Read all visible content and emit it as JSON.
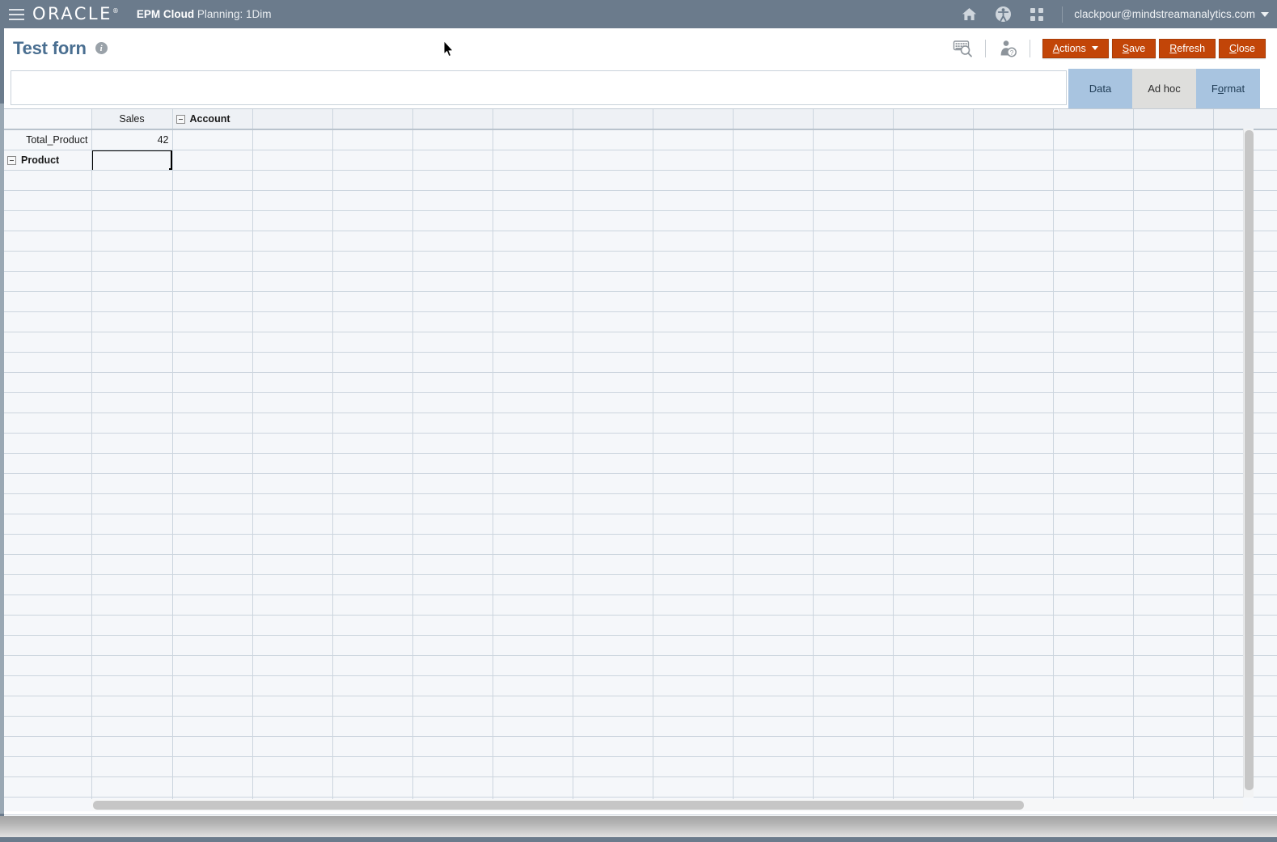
{
  "global_header": {
    "menu_icon": "hamburger-menu-icon",
    "brand": "ORACLE",
    "brand_mark": "®",
    "app_name_bold": "EPM Cloud",
    "app_name_rest": " Planning: 1Dim",
    "icons": [
      {
        "name": "home-icon",
        "glyph": "⌂"
      },
      {
        "name": "accessibility-icon",
        "glyph": "Ⓙ"
      },
      {
        "name": "app-switcher-icon",
        "glyph": "∷"
      }
    ],
    "user": "clackpour@mindstreamanalytics.com"
  },
  "title_bar": {
    "title": "Test forn",
    "info_glyph": "i",
    "tool_icons": [
      {
        "name": "keyboard-search-icon"
      },
      {
        "name": "user-help-icon"
      }
    ],
    "buttons": [
      {
        "name": "actions-button",
        "label": "Actions",
        "accel": "A",
        "caret": true
      },
      {
        "name": "save-button",
        "label": "Save",
        "accel": "S",
        "caret": false
      },
      {
        "name": "refresh-button",
        "label": "Refresh",
        "accel": "R",
        "caret": false
      },
      {
        "name": "close-button",
        "label": "Close",
        "accel": "C",
        "caret": false
      }
    ]
  },
  "pov": {
    "value": "",
    "placeholder": ""
  },
  "side_tabs": [
    {
      "name": "tab-data",
      "label": "Data",
      "accel": "",
      "active": true
    },
    {
      "name": "tab-adhoc",
      "label": "Ad hoc",
      "accel": "",
      "active": false
    },
    {
      "name": "tab-format",
      "label": "Format",
      "accel": "o",
      "active": true
    }
  ],
  "grid": {
    "column_headers": [
      "",
      "Sales",
      "Account"
    ],
    "account_header_collapsible": true,
    "blank_column_count": 13,
    "rows": [
      {
        "header": "Total_Product",
        "bold": false,
        "expandable": false,
        "cells": [
          {
            "value": "42",
            "state": "dirty"
          },
          {
            "value": "",
            "state": "normal"
          }
        ]
      },
      {
        "header": "Product",
        "bold": true,
        "expandable": true,
        "cells": [
          {
            "value": "",
            "state": "selected"
          },
          {
            "value": "",
            "state": "normal"
          }
        ]
      }
    ],
    "empty_row_count": 32
  },
  "scrollbars": {
    "vertical": {
      "name": "vertical-scrollbar"
    },
    "horizontal": {
      "name": "horizontal-scrollbar"
    }
  },
  "colors": {
    "header_bg": "#6b7b8c",
    "accent_button": "#c24508",
    "title_text": "#4a6f91",
    "tab_active": "#a8c4e0",
    "tab_inactive": "#dededc",
    "dirty_cell": "#fdfbd9",
    "grid_cell": "#f5f7fa",
    "gridline": "#ccd5de"
  }
}
